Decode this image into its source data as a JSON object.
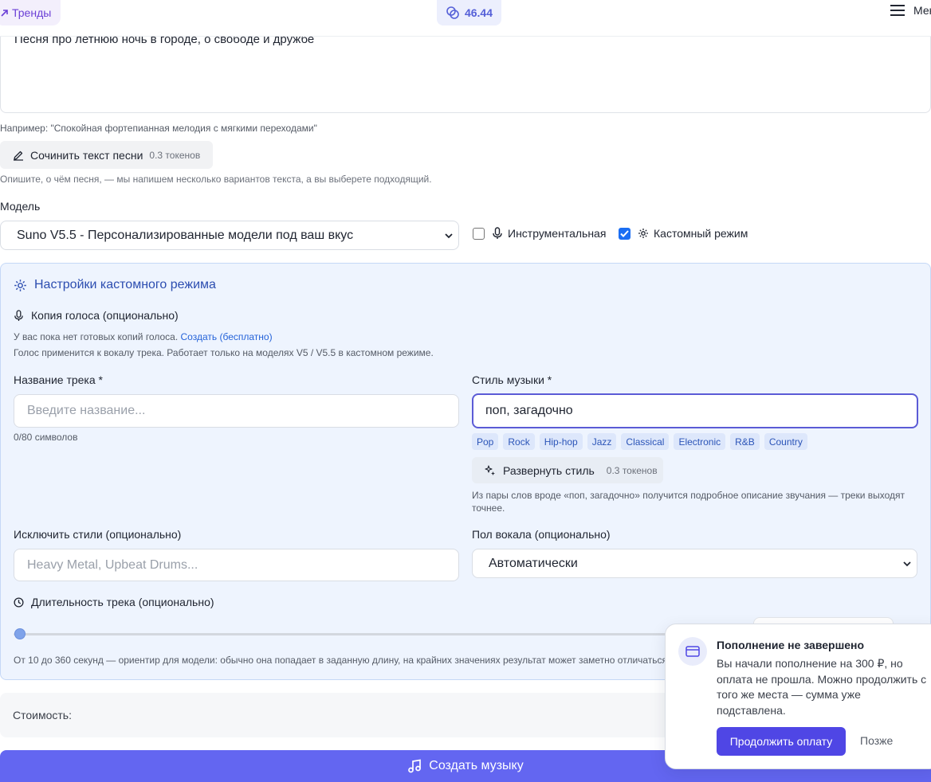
{
  "topbar": {
    "trends_label": "Тренды",
    "balance": "46.44",
    "menu_label": "Меню"
  },
  "prompt": {
    "text": "Песня про летнюю ночь в городе, о свободе и дружбе",
    "example": "Например: \"Спокойная фортепианная мелодия с мягкими переходами\""
  },
  "lyrics": {
    "button_label": "Сочинить текст песни",
    "cost": "0.3 токенов",
    "hint": "Опишите, о чём песня, — мы напишем несколько вариантов текста, а вы выберете подходящий."
  },
  "model": {
    "label": "Модель",
    "selected": "Suno V5.5 - Персонализированные модели под ваш вкус"
  },
  "options": {
    "instrumental_label": "Инструментальная",
    "instrumental_checked": false,
    "custom_label": "Кастомный режим",
    "custom_checked": true
  },
  "custom": {
    "title": "Настройки кастомного режима",
    "voice_label": "Копия голоса (опционально)",
    "voice_info": "У вас пока нет готовых копий голоса.",
    "voice_create_link": "Создать (бесплатно)",
    "voice_note": "Голос применится к вокалу трека. Работает только на моделях V5 / V5.5 в кастомном режиме.",
    "track_name_label": "Название трека *",
    "track_name_placeholder": "Введите название...",
    "track_name_counter": "0/80 символов",
    "style_label": "Стиль музыки *",
    "style_value": "поп, загадочно",
    "style_tags": [
      "Pop",
      "Rock",
      "Hip-hop",
      "Jazz",
      "Classical",
      "Electronic",
      "R&B",
      "Country"
    ],
    "expand_label": "Развернуть стиль",
    "expand_cost": "0.3 токенов",
    "expand_note": "Из пары слов вроде «поп, загадочно» получится подробное описание звучания — треки выходят точнее.",
    "exclude_label": "Исключить стили (опционально)",
    "exclude_placeholder": "Heavy Metal, Upbeat Drums...",
    "vocal_label": "Пол вокала (опционально)",
    "vocal_selected": "Автоматически",
    "duration_label": "Длительность трека (опционально)",
    "duration_note": "От 10 до 360 секунд — ориентир для модели: обычно она попадает в заданную длину, на крайних значениях результат может заметно отличаться."
  },
  "cost": {
    "label": "Стоимость:"
  },
  "create_button": "Создать музыку",
  "toast": {
    "title": "Пополнение не завершено",
    "body": "Вы начали пополнение на 300 ₽, но оплата не прошла. Можно продолжить с того же места — сумма уже подставлена.",
    "primary": "Продолжить оплату",
    "secondary": "Позже"
  },
  "colors": {
    "accent": "#6366f1",
    "panel_bg": "#eef4fe",
    "link": "#2563d9"
  }
}
